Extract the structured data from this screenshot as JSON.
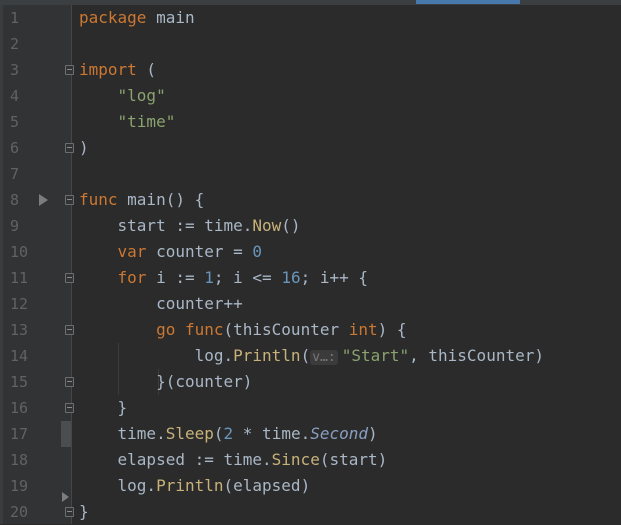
{
  "editor": {
    "language": "go",
    "lines": [
      {
        "n": "1",
        "tokens": [
          [
            "package",
            "kw"
          ],
          [
            " main",
            "text"
          ]
        ]
      },
      {
        "n": "2",
        "tokens": []
      },
      {
        "n": "3",
        "tokens": [
          [
            "import",
            "kw"
          ],
          [
            " (",
            "text"
          ]
        ]
      },
      {
        "n": "4",
        "tokens": [
          [
            "    ",
            "text"
          ],
          [
            "\"log\"",
            "str"
          ]
        ]
      },
      {
        "n": "5",
        "tokens": [
          [
            "    ",
            "text"
          ],
          [
            "\"time\"",
            "str"
          ]
        ]
      },
      {
        "n": "6",
        "tokens": [
          [
            ")",
            "text"
          ]
        ]
      },
      {
        "n": "7",
        "tokens": []
      },
      {
        "n": "8",
        "tokens": [
          [
            "func",
            "kw"
          ],
          [
            " main() {",
            "text"
          ]
        ]
      },
      {
        "n": "9",
        "tokens": [
          [
            "    start := time.",
            "text"
          ],
          [
            "Now",
            "fn"
          ],
          [
            "()",
            "text"
          ]
        ]
      },
      {
        "n": "10",
        "tokens": [
          [
            "    ",
            "text"
          ],
          [
            "var",
            "kw"
          ],
          [
            " counter = ",
            "text"
          ],
          [
            "0",
            "num"
          ]
        ]
      },
      {
        "n": "11",
        "tokens": [
          [
            "    ",
            "text"
          ],
          [
            "for",
            "kw"
          ],
          [
            " i := ",
            "text"
          ],
          [
            "1",
            "num"
          ],
          [
            "; i <= ",
            "text"
          ],
          [
            "16",
            "num"
          ],
          [
            "; i++ {",
            "text"
          ]
        ]
      },
      {
        "n": "12",
        "tokens": [
          [
            "        counter++",
            "text"
          ]
        ]
      },
      {
        "n": "13",
        "tokens": [
          [
            "        ",
            "text"
          ],
          [
            "go",
            "kw"
          ],
          [
            " ",
            "text"
          ],
          [
            "func",
            "kw"
          ],
          [
            "(thisCounter ",
            "text"
          ],
          [
            "int",
            "kw"
          ],
          [
            ") {",
            "text"
          ]
        ]
      },
      {
        "n": "14",
        "tokens": [
          [
            "            log.",
            "text"
          ],
          [
            "Println",
            "fn"
          ],
          [
            "(",
            "text"
          ],
          [
            "v…:",
            "hint"
          ],
          [
            "\"Start\"",
            "str"
          ],
          [
            ", thisCounter)",
            "text"
          ]
        ]
      },
      {
        "n": "15",
        "tokens": [
          [
            "        }(counter)",
            "text"
          ]
        ]
      },
      {
        "n": "16",
        "tokens": [
          [
            "    }",
            "text"
          ]
        ]
      },
      {
        "n": "17",
        "tokens": [
          [
            "    time.",
            "text"
          ],
          [
            "Sleep",
            "fn"
          ],
          [
            "(",
            "text"
          ],
          [
            "2",
            "num"
          ],
          [
            " * time.",
            "text"
          ],
          [
            "Second",
            "const"
          ],
          [
            ")",
            "text"
          ]
        ]
      },
      {
        "n": "18",
        "tokens": [
          [
            "    elapsed := time.",
            "text"
          ],
          [
            "Since",
            "fn"
          ],
          [
            "(start)",
            "text"
          ]
        ]
      },
      {
        "n": "19",
        "tokens": [
          [
            "    log.",
            "text"
          ],
          [
            "Println",
            "fn"
          ],
          [
            "(elapsed)",
            "text"
          ]
        ]
      },
      {
        "n": "20",
        "tokens": [
          [
            "}",
            "text"
          ]
        ]
      }
    ],
    "fold_lines": [
      3,
      6,
      8,
      11,
      13,
      15,
      16,
      20
    ],
    "colors": {
      "background": "#2b2b2b",
      "gutter": "#313335",
      "keyword": "#cc7832",
      "string": "#8aa36f",
      "number": "#6897bb"
    }
  }
}
